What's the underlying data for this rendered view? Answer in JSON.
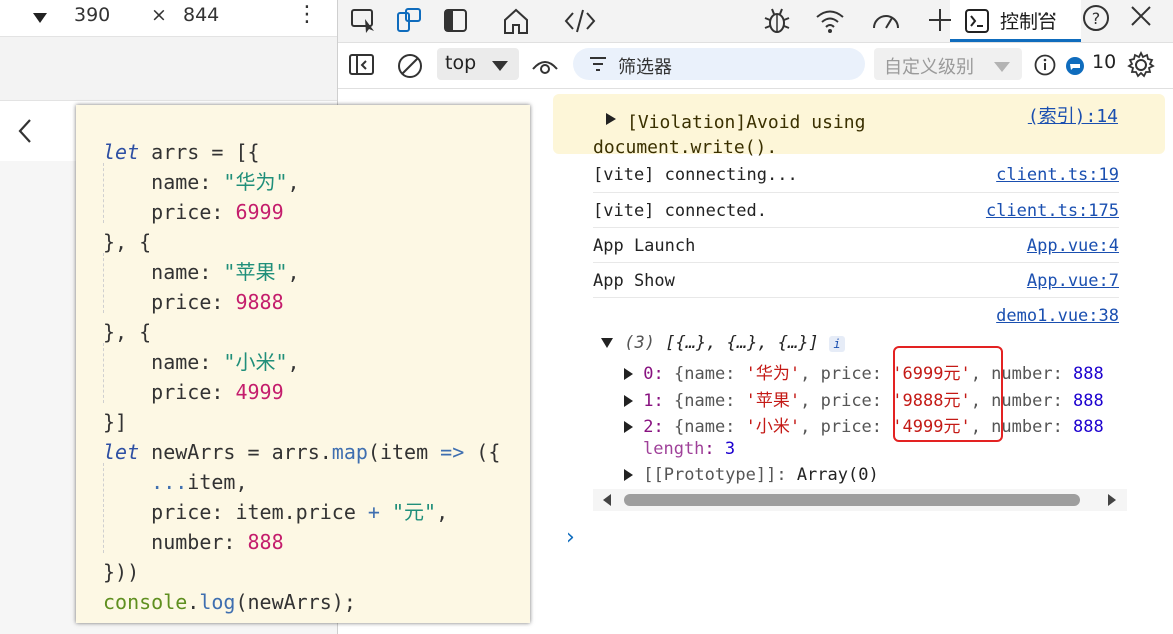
{
  "device": {
    "width": "390",
    "times": "×",
    "height": "844"
  },
  "devtools": {
    "tabs": {
      "console_label": "控制台"
    },
    "toolbar": {
      "context": "top",
      "filter_label": "筛选器",
      "level_label": "自定义级别",
      "issue_count": "10"
    },
    "messages": {
      "warning_line1": "[Violation]Avoid using",
      "warning_line2": "document.write().",
      "warning_source": "(索引):14",
      "log1_text": "[vite] connecting...",
      "log1_source": "client.ts:19",
      "log2_text": "[vite] connected.",
      "log2_source": "client.ts:175",
      "log3_text": "App Launch",
      "log3_source": "App.vue:4",
      "log4_text": "App Show",
      "log4_source": "App.vue:7",
      "log5_source": "demo1.vue:38"
    },
    "array_preview": {
      "count": "(3)",
      "summary": "[{…}, {…}, {…}]",
      "items": [
        {
          "index": "0",
          "name": "'华为'",
          "price": "'6999元'",
          "number": "888"
        },
        {
          "index": "1",
          "name": "'苹果'",
          "price": "'9888元'",
          "number": "888"
        },
        {
          "index": "2",
          "name": "'小米'",
          "price": "'4999元'",
          "number": "888"
        }
      ],
      "length_key": "length",
      "length_value": "3",
      "prototype_key": "[[Prototype]]",
      "prototype_value": "Array(0)"
    }
  },
  "code": {
    "lines": [
      "let arrs = [{",
      "    name: \"华为\",",
      "    price: 6999",
      "}, {",
      "    name: \"苹果\",",
      "    price: 9888",
      "}, {",
      "    name: \"小米\",",
      "    price: 4999",
      "}]",
      "let newArrs = arrs.map(item => ({",
      "    ...item,",
      "    price: item.price + \"元\",",
      "    number: 888",
      "}))",
      "console.log(newArrs);"
    ]
  },
  "colors": {
    "accent": "#0f6cbd",
    "highlight_box": "#e32222",
    "warning_bg": "#fdf6d8",
    "code_bg": "#fdf8e4"
  }
}
